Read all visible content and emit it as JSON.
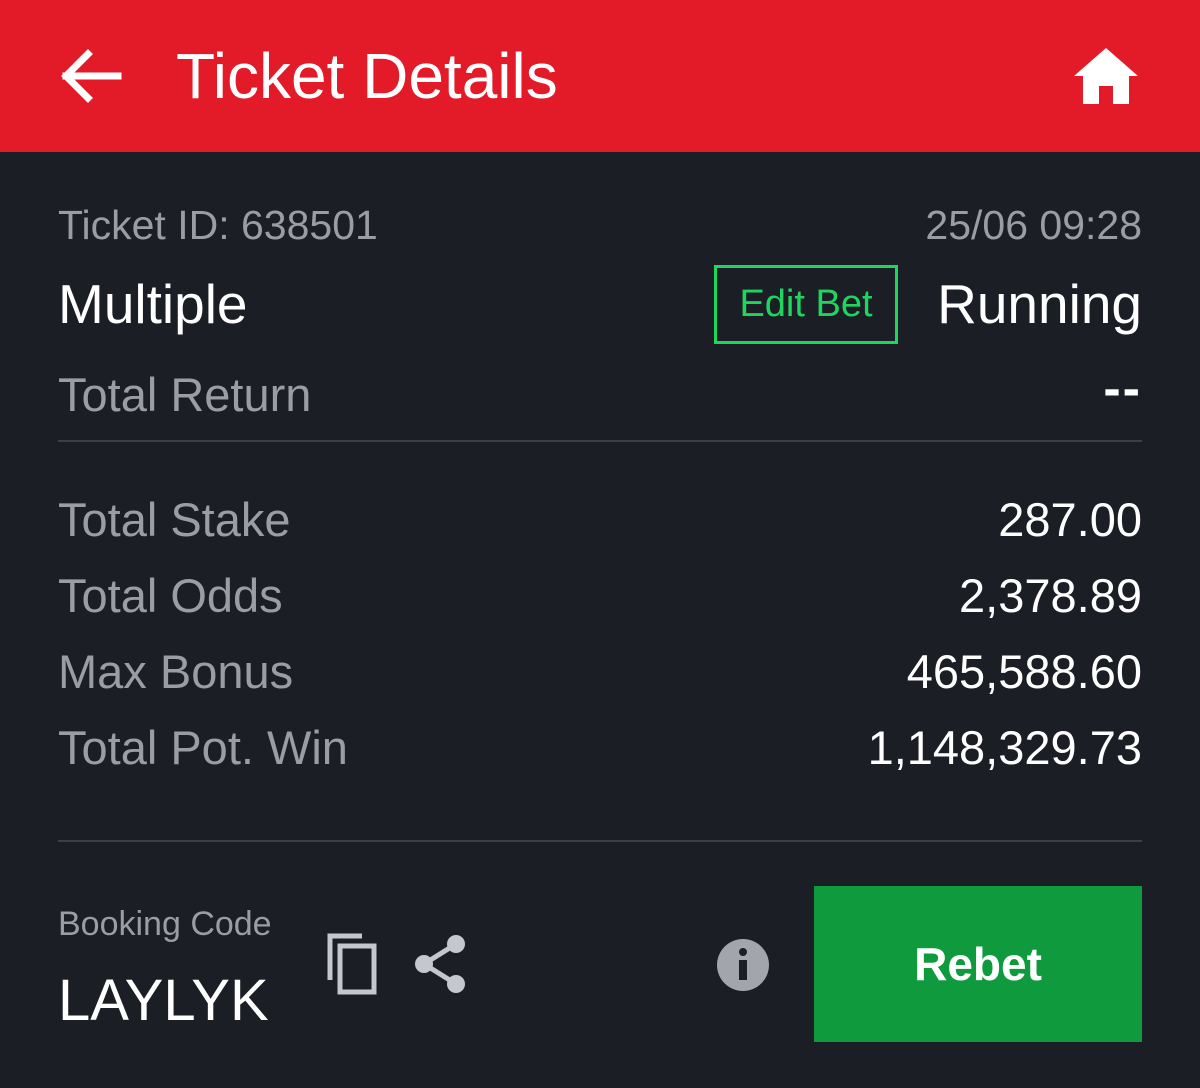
{
  "header": {
    "title": "Ticket Details",
    "back_icon": "arrow-left-icon",
    "home_icon": "home-icon",
    "background_color": "#e31b29"
  },
  "ticket": {
    "id_text": "Ticket ID: 638501",
    "datetime": "25/06 09:28",
    "type": "Multiple",
    "edit_bet_label": "Edit Bet",
    "status": "Running",
    "total_return_label": "Total Return",
    "total_return_value": "--"
  },
  "summary": [
    {
      "label": "Total Stake",
      "value": "287.00"
    },
    {
      "label": "Total Odds",
      "value": "2,378.89"
    },
    {
      "label": "Max Bonus",
      "value": "465,588.60"
    },
    {
      "label": "Total Pot. Win",
      "value": "1,148,329.73"
    }
  ],
  "booking": {
    "label": "Booking Code",
    "code": "LAYLYK",
    "copy_icon": "copy-icon",
    "share_icon": "share-icon",
    "info_icon": "info-icon"
  },
  "rebet_label": "Rebet",
  "colors": {
    "accent_red": "#e31b29",
    "edit_green": "#1ed65f",
    "rebet_green": "#0f9b3d",
    "background": "#1b1e25"
  }
}
